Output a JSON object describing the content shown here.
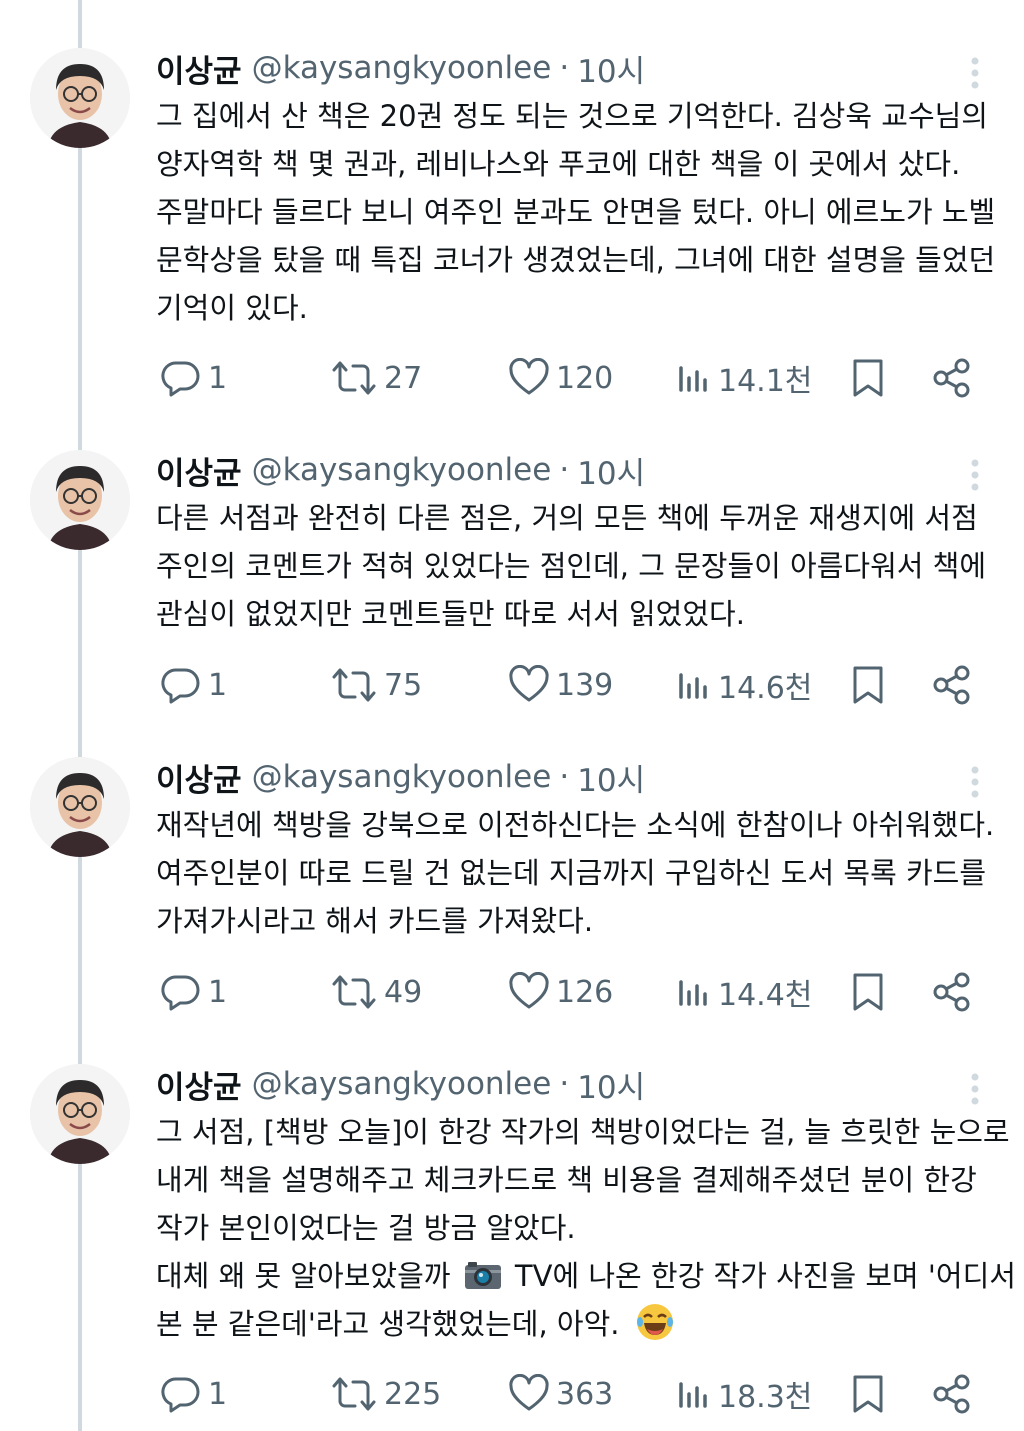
{
  "tweets": [
    {
      "name": "이상균",
      "handle": "@kaysangkyoonlee",
      "dot": "·",
      "time": "10시",
      "lines": [
        "그 집에서 산 책은 20권 정도 되는 것으로 기억한다. 김상욱 교수님의",
        "양자역학 책 몇 권과, 레비나스와 푸코에 대한 책을 이 곳에서 샀다.",
        "주말마다 들르다 보니 여주인 분과도 안면을 텄다. 아니 에르노가 노벨",
        "문학상을 탔을 때 특집 코너가 생겼었는데, 그녀에 대한 설명을 들었던",
        "기억이 있다."
      ],
      "replies": "1",
      "retweets": "27",
      "likes": "120",
      "views": "14.1천"
    },
    {
      "name": "이상균",
      "handle": "@kaysangkyoonlee",
      "dot": "·",
      "time": "10시",
      "lines": [
        "다른 서점과 완전히 다른 점은, 거의 모든 책에 두꺼운 재생지에 서점",
        "주인의 코멘트가 적혀 있었다는 점인데, 그 문장들이 아름다워서 책에",
        "관심이 없었지만 코멘트들만 따로 서서 읽었었다."
      ],
      "replies": "1",
      "retweets": "75",
      "likes": "139",
      "views": "14.6천"
    },
    {
      "name": "이상균",
      "handle": "@kaysangkyoonlee",
      "dot": "·",
      "time": "10시",
      "lines": [
        "재작년에 책방을 강북으로 이전하신다는 소식에 한참이나 아쉬워했다.",
        "여주인분이 따로 드릴 건 없는데 지금까지 구입하신 도서 목록 카드를",
        "가져가시라고 해서 카드를 가져왔다."
      ],
      "replies": "1",
      "retweets": "49",
      "likes": "126",
      "views": "14.4천"
    },
    {
      "name": "이상균",
      "handle": "@kaysangkyoonlee",
      "dot": "·",
      "time": "10시",
      "lines": [
        "그 서점, [책방 오늘]이 한강 작가의 책방이었다는 걸, 늘 흐릿한 눈으로",
        "내게 책을 설명해주고 체크카드로 책 비용을 결제해주셨던 분이 한강",
        "작가 본인이었다는 걸 방금 알았다."
      ],
      "line4a": "대체 왜 못 알아보았을까",
      "line4b": "TV에 나온 한강 작가 사진을 보며 '어디서",
      "line5": "본 분 같은데'라고 생각했었는데, 아악.",
      "replies": "1",
      "retweets": "225",
      "likes": "363",
      "views": "18.3천"
    }
  ],
  "icons": {
    "reply": "reply-icon",
    "retweet": "retweet-icon",
    "like": "heart-icon",
    "views": "views-icon",
    "bookmark": "bookmark-icon",
    "share": "share-icon",
    "more": "more-vertical-icon",
    "camera": "camera-emoji",
    "laugh": "laughing-emoji"
  },
  "colors": {
    "text": "#0f1419",
    "secondary": "#536471",
    "thread_line": "#cfd9de"
  }
}
